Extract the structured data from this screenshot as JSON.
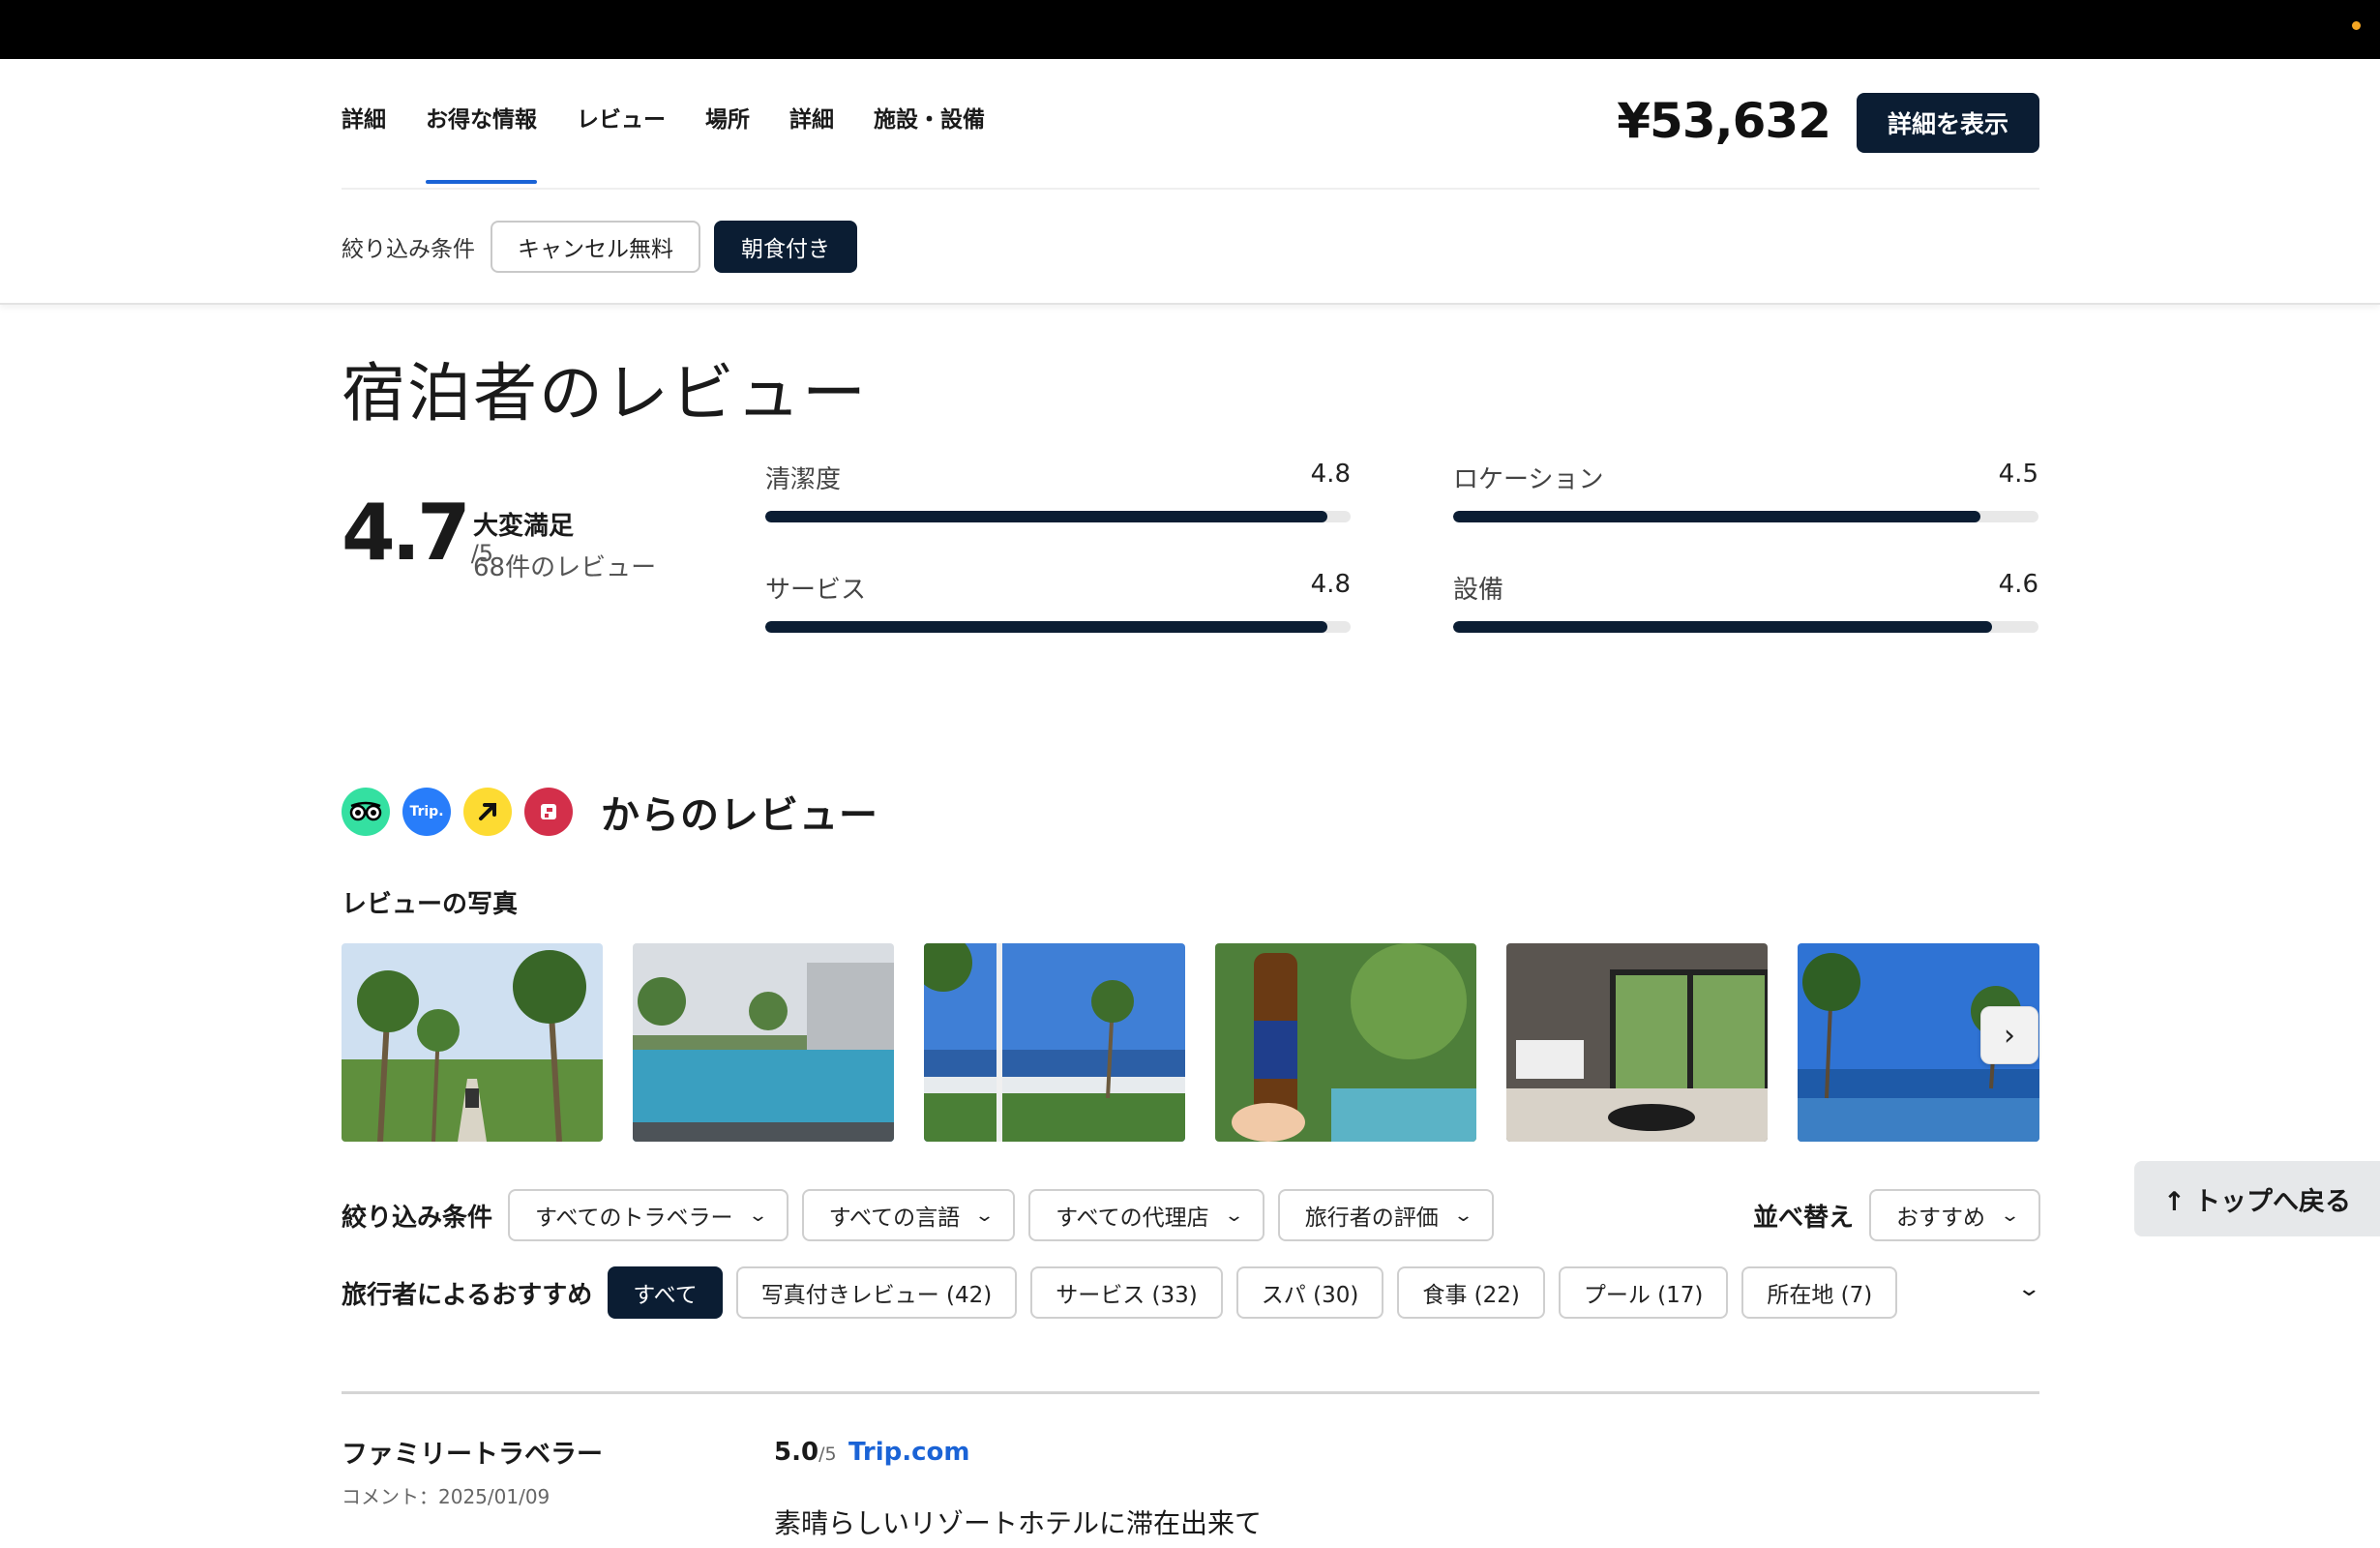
{
  "header": {
    "tabs": [
      "詳細",
      "お得な情報",
      "レビュー",
      "場所",
      "詳細",
      "施設・設備"
    ],
    "active_tab": 1,
    "price": "¥53,632",
    "detail_button": "詳細を表示",
    "filter_label": "絞り込み条件",
    "filter_chips": [
      {
        "label": "キャンセル無料",
        "selected": false
      },
      {
        "label": "朝食付き",
        "selected": true
      }
    ]
  },
  "reviews": {
    "heading": "宿泊者のレビュー",
    "overall_score": "4.7",
    "out_of": "/5",
    "rating_word": "大変満足",
    "review_count": "68件のレビュー",
    "categories": [
      {
        "label": "清潔度",
        "value": "4.8",
        "fraction": 0.96
      },
      {
        "label": "ロケーション",
        "value": "4.5",
        "fraction": 0.9
      },
      {
        "label": "サービス",
        "value": "4.8",
        "fraction": 0.96
      },
      {
        "label": "設備",
        "value": "4.6",
        "fraction": 0.92
      }
    ]
  },
  "sources": {
    "title": "からのレビュー",
    "icons": [
      {
        "name": "tripadvisor-icon",
        "text": "",
        "color": "#34e0a1"
      },
      {
        "name": "trip-com-icon",
        "text": "Trip.",
        "color": "#287dfa"
      },
      {
        "name": "expedia-icon",
        "text": "",
        "color": "#fddb32"
      },
      {
        "name": "hotels-com-icon",
        "text": "",
        "color": "#d32f4a"
      }
    ]
  },
  "photos": {
    "title": "レビューの写真",
    "items": [
      "palm-path-photo",
      "pool-photo",
      "beach-photo",
      "beer-photo",
      "room-photo",
      "seaside-pool-photo"
    ],
    "next_icon": "›"
  },
  "review_filters": {
    "label": "絞り込み条件",
    "dropdowns": [
      "すべてのトラベラー",
      "すべての言語",
      "すべての代理店",
      "旅行者の評価"
    ],
    "sort_label": "並べ替え",
    "sort_value": "おすすめ"
  },
  "back_to_top": "↑ トップへ戻る",
  "recommendations": {
    "label": "旅行者によるおすすめ",
    "pills": [
      {
        "label": "すべて",
        "selected": true
      },
      {
        "label": "写真付きレビュー (42)",
        "selected": false
      },
      {
        "label": "サービス (33)",
        "selected": false
      },
      {
        "label": "スパ (30)",
        "selected": false
      },
      {
        "label": "食事 (22)",
        "selected": false
      },
      {
        "label": "プール (17)",
        "selected": false
      },
      {
        "label": "所在地 (7)",
        "selected": false
      }
    ]
  },
  "review_item": {
    "reviewer": "ファミリートラベラー",
    "date": "コメント：2025/01/09",
    "score": "5.0",
    "out_of": "/5",
    "source": "Trip.com",
    "text": "素晴らしいリゾートホテルに滞在出来て"
  },
  "colors": {
    "navy": "#0b1d33",
    "accent_blue": "#1a63d6"
  }
}
